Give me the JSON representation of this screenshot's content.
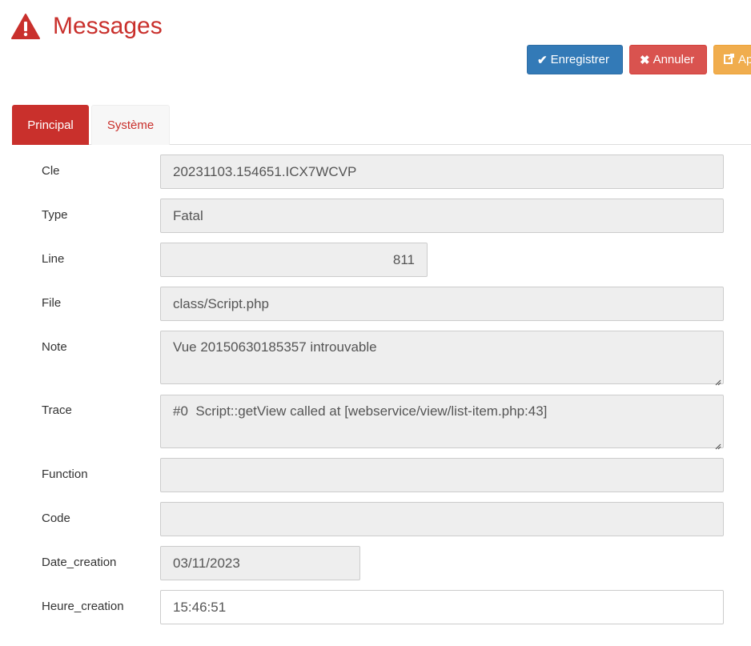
{
  "header": {
    "title": "Messages",
    "icon": "warning-icon"
  },
  "toolbar": {
    "save_label": "Enregistrer",
    "cancel_label": "Annuler",
    "apply_label": "Ap",
    "save_icon": "check-icon",
    "cancel_icon": "times-icon",
    "apply_icon": "share-icon"
  },
  "tabs": [
    {
      "label": "Principal",
      "active": true
    },
    {
      "label": "Système",
      "active": false
    }
  ],
  "form": {
    "cle": {
      "label": "Cle",
      "value": "20231103.154651.ICX7WCVP"
    },
    "type": {
      "label": "Type",
      "value": "Fatal"
    },
    "line": {
      "label": "Line",
      "value": "811"
    },
    "file": {
      "label": "File",
      "value": "class/Script.php"
    },
    "note": {
      "label": "Note",
      "value": "Vue 20150630185357 introuvable"
    },
    "trace": {
      "label": "Trace",
      "value": "#0  Script::getView called at [webservice/view/list-item.php:43]"
    },
    "function": {
      "label": "Function",
      "value": ""
    },
    "code": {
      "label": "Code",
      "value": ""
    },
    "date_creation": {
      "label": "Date_creation",
      "value": "03/11/2023"
    },
    "heure_creation": {
      "label": "Heure_creation",
      "value": "15:46:51"
    }
  },
  "colors": {
    "accent": "#c9302c",
    "primary": "#337ab7",
    "danger": "#d9534f",
    "warning": "#f0ad4e"
  }
}
